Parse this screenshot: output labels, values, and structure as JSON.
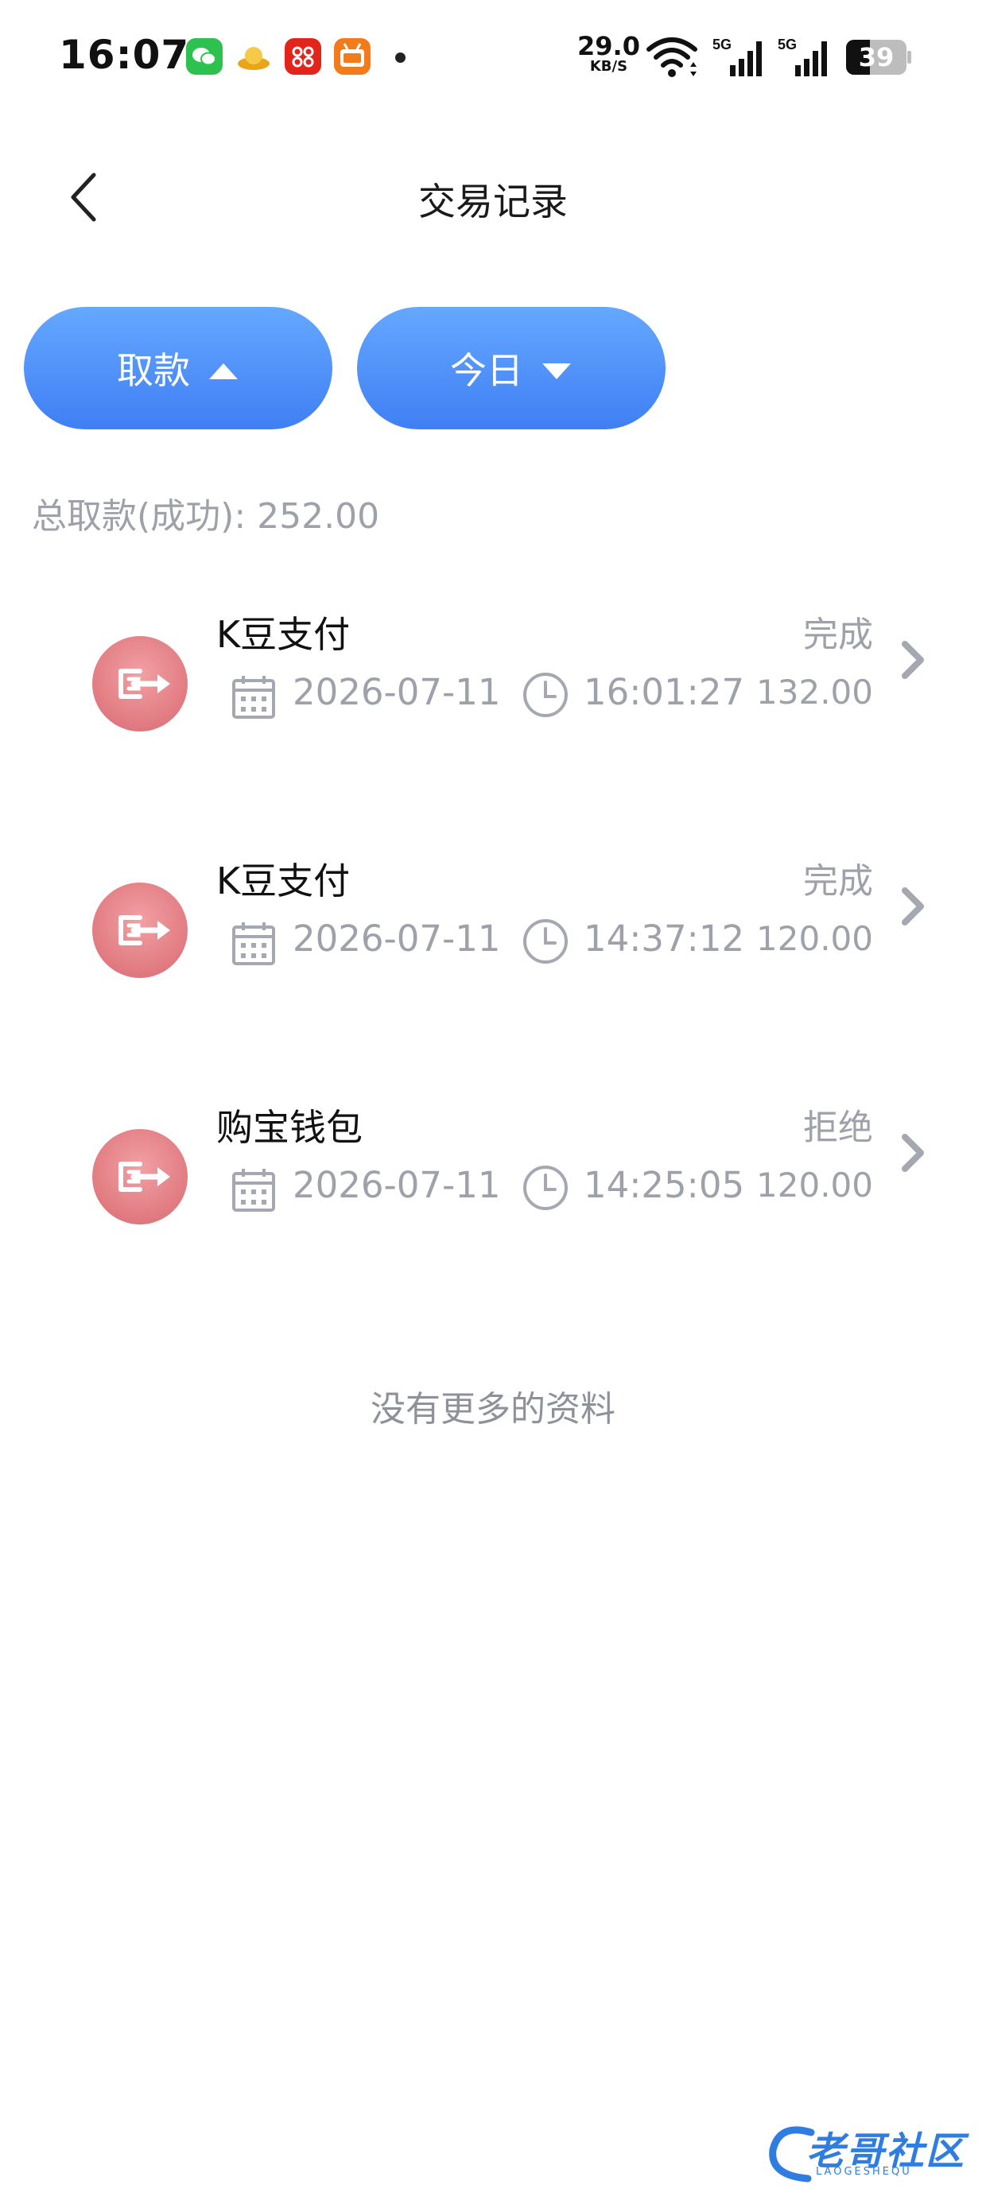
{
  "status_bar": {
    "time": "16:07",
    "net_speed_value": "29.0",
    "net_speed_unit": "KB/S",
    "signal_1_label": "5G",
    "signal_2_label": "5G",
    "battery_level": "39",
    "battery_fraction": 0.39
  },
  "header": {
    "title": "交易记录"
  },
  "filters": {
    "type_label": "取款",
    "period_label": "今日",
    "accent_gradient": [
      "#64a8ff",
      "#3f7ff4"
    ]
  },
  "summary": {
    "text": "总取款(成功): 252.00"
  },
  "records": [
    {
      "name": "K豆支付",
      "status": "完成",
      "date": "2026-07-11",
      "time": "16:01:27",
      "amount": "132.00"
    },
    {
      "name": "K豆支付",
      "status": "完成",
      "date": "2026-07-11",
      "time": "14:37:12",
      "amount": "120.00"
    },
    {
      "name": "购宝钱包",
      "status": "拒绝",
      "date": "2026-07-11",
      "time": "14:25:05",
      "amount": "120.00"
    }
  ],
  "footer": {
    "no_more_text": "没有更多的资料"
  },
  "watermark": {
    "text": "老哥社区",
    "sub": "LAOGESHEQU"
  },
  "icons": {
    "record_icon": "withdraw-arrow-icon",
    "date_icon": "calendar-icon",
    "time_icon": "clock-icon",
    "row_action": "chevron-right-icon"
  }
}
